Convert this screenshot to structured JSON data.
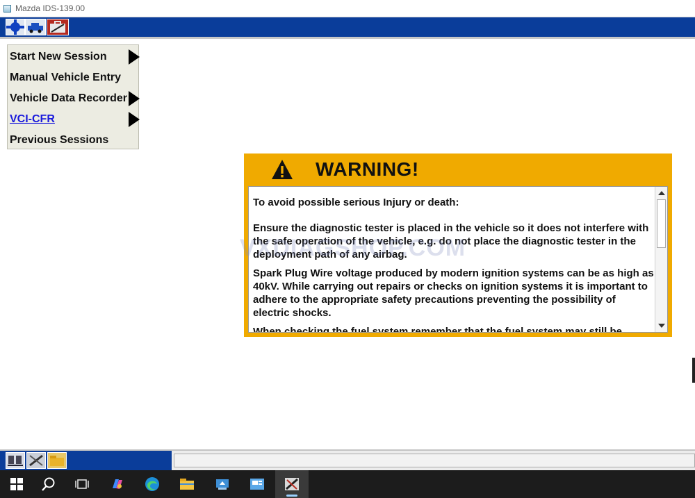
{
  "window": {
    "title": "Mazda IDS-139.00"
  },
  "menu": {
    "items": [
      {
        "label": "Start New Session",
        "has_submenu": true,
        "link": false
      },
      {
        "label": "Manual Vehicle Entry",
        "has_submenu": false,
        "link": false
      },
      {
        "label": "Vehicle Data Recorder",
        "has_submenu": true,
        "link": false
      },
      {
        "label": "VCI-CFR",
        "has_submenu": true,
        "link": true
      },
      {
        "label": "Previous Sessions",
        "has_submenu": false,
        "link": false
      }
    ]
  },
  "warning": {
    "title": "WARNING!",
    "paragraphs": [
      "To avoid possible serious Injury or death:",
      "Ensure the diagnostic tester is placed in the vehicle so it does not interfere with the safe operation of the vehicle, e.g. do not place the diagnostic tester in the deployment path of any airbag.",
      "Spark Plug Wire voltage produced by modern ignition systems can be as high as 40kV. While carrying out repairs or checks on ignition systems it is important to adhere to the appropriate safety precautions preventing the possibility of electric shocks.",
      "When checking the fuel system remember that the fuel system may still be"
    ]
  },
  "watermark": "VXDIAGSHOP.COM",
  "colors": {
    "toolbar_blue": "#0a3d9a",
    "warning_amber": "#f0aa00",
    "menu_bg": "#ecece2",
    "link_blue": "#1a1adc",
    "taskbar": "#1c1c1c"
  },
  "taskbar": {
    "icons": [
      "windows-start-icon",
      "search-icon",
      "task-view-icon",
      "copilot-icon",
      "edge-browser-icon",
      "file-explorer-icon",
      "installer-icon",
      "remote-desktop-icon",
      "ids-app-icon"
    ]
  }
}
